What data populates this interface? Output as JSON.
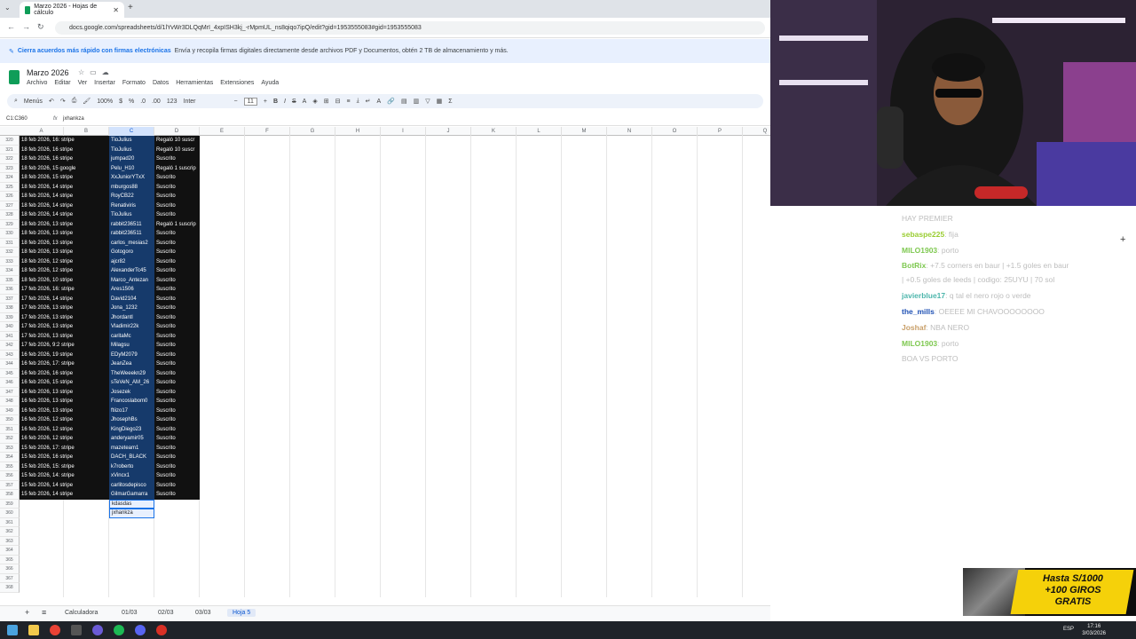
{
  "browser": {
    "tab_title": "Marzo 2026 - Hojas de cálculo",
    "url": "docs.google.com/spreadsheets/d/1lYvWr3DLQqMrI_4xpISH3kj_-rMpmUL_ns8qiqo7ipQ/edit?gid=1953555083#gid=1953555083"
  },
  "banner": {
    "bold": "Cierra acuerdos más rápido con firmas electrónicas",
    "text": "Envía y recopila firmas digitales directamente desde archivos PDF y Documentos, obtén 2 TB de almacenamiento y más."
  },
  "doc": {
    "title": "Marzo 2026",
    "menu": [
      "Archivo",
      "Editar",
      "Ver",
      "Insertar",
      "Formato",
      "Datos",
      "Herramientas",
      "Extensiones",
      "Ayuda"
    ]
  },
  "toolbar": {
    "menus": "Menús",
    "zoom": "100%",
    "currency": "$",
    "percent": "%",
    "num": "123",
    "font": "Inter",
    "size": "11"
  },
  "formula": {
    "ref": "C1:C360",
    "value": "jxhankza"
  },
  "columns": [
    "A",
    "B",
    "C",
    "D",
    "E",
    "F",
    "G",
    "H",
    "I",
    "J",
    "K",
    "L",
    "M",
    "N",
    "O",
    "P",
    "Q"
  ],
  "rows": [
    {
      "n": "320",
      "a": "18 feb 2026, 16: stripe",
      "c": "TioJulius",
      "d": "Regaló 10 suscr"
    },
    {
      "n": "321",
      "a": "18 feb 2026, 16 stripe",
      "c": "TioJulius",
      "d": "Regaló 10 suscr"
    },
    {
      "n": "322",
      "a": "18 feb 2026, 16 stripe",
      "c": "jumpad20",
      "d": "Suscrito"
    },
    {
      "n": "323",
      "a": "18 feb 2026, 15 google",
      "c": "Pelu_H10",
      "d": "Regaló 1 suscrip"
    },
    {
      "n": "324",
      "a": "18 feb 2026, 15 stripe",
      "c": "XxJuniorYTxX",
      "d": "Suscrito"
    },
    {
      "n": "325",
      "a": "18 feb 2026, 14 stripe",
      "c": "mburgos88",
      "d": "Suscrito"
    },
    {
      "n": "326",
      "a": "18 feb 2026, 14 stripe",
      "c": "RoyCB22",
      "d": "Suscrito"
    },
    {
      "n": "327",
      "a": "18 feb 2026, 14 stripe",
      "c": "Renativiris",
      "d": "Suscrito"
    },
    {
      "n": "328",
      "a": "18 feb 2026, 14 stripe",
      "c": "TioJulius",
      "d": "Suscrito"
    },
    {
      "n": "329",
      "a": "18 feb 2026, 13 stripe",
      "c": "rabbit236511",
      "d": "Regaló 1 suscrip"
    },
    {
      "n": "330",
      "a": "18 feb 2026, 13 stripe",
      "c": "rabbit236511",
      "d": "Suscrito"
    },
    {
      "n": "331",
      "a": "18 feb 2026, 13 stripe",
      "c": "carlos_mesias2",
      "d": "Suscrito"
    },
    {
      "n": "332",
      "a": "18 feb 2026, 13 stripe",
      "c": "Gotogoro",
      "d": "Suscrito"
    },
    {
      "n": "333",
      "a": "18 feb 2026, 12 stripe",
      "c": "ajcr82",
      "d": "Suscrito"
    },
    {
      "n": "334",
      "a": "18 feb 2026, 12 stripe",
      "c": "AlexanderTc45",
      "d": "Suscrito"
    },
    {
      "n": "335",
      "a": "18 feb 2026, 10 stripe",
      "c": "Marco_Antezan",
      "d": "Suscrito"
    },
    {
      "n": "336",
      "a": "17 feb 2026, 16: stripe",
      "c": "Ares1506",
      "d": "Suscrito"
    },
    {
      "n": "337",
      "a": "17 feb 2026, 14 stripe",
      "c": "David2104",
      "d": "Suscrito"
    },
    {
      "n": "338",
      "a": "17 feb 2026, 13 stripe",
      "c": "Jona_1232",
      "d": "Suscrito"
    },
    {
      "n": "339",
      "a": "17 feb 2026, 13 stripe",
      "c": "Jhordantl",
      "d": "Suscrito"
    },
    {
      "n": "340",
      "a": "17 feb 2026, 13 stripe",
      "c": "Vladimir22k",
      "d": "Suscrito"
    },
    {
      "n": "341",
      "a": "17 feb 2026, 13 stripe",
      "c": "caritaMc",
      "d": "Suscrito"
    },
    {
      "n": "342",
      "a": "17 feb 2026, 9:2 stripe",
      "c": "Milagsu",
      "d": "Suscrito"
    },
    {
      "n": "343",
      "a": "16 feb 2026, 19 stripe",
      "c": "EDyM2079",
      "d": "Suscrito"
    },
    {
      "n": "344",
      "a": "16 feb 2026, 17: stripe",
      "c": "JeanZea",
      "d": "Suscrito"
    },
    {
      "n": "345",
      "a": "16 feb 2026, 16 stripe",
      "c": "TheWeeekn29",
      "d": "Suscrito"
    },
    {
      "n": "346",
      "a": "16 feb 2026, 15 stripe",
      "c": "sTeVeN_AM_26",
      "d": "Suscrito"
    },
    {
      "n": "347",
      "a": "16 feb 2026, 13 stripe",
      "c": "Josezek",
      "d": "Suscrito"
    },
    {
      "n": "348",
      "a": "16 feb 2026, 13 stripe",
      "c": "Francoslabom0",
      "d": "Suscrito"
    },
    {
      "n": "349",
      "a": "16 feb 2026, 13 stripe",
      "c": "ftiizo17",
      "d": "Suscrito"
    },
    {
      "n": "350",
      "a": "16 feb 2026, 12 stripe",
      "c": "JhosephBs",
      "d": "Suscrito"
    },
    {
      "n": "351",
      "a": "16 feb 2026, 12 stripe",
      "c": "KingDiego23",
      "d": "Suscrito"
    },
    {
      "n": "352",
      "a": "16 feb 2026, 12 stripe",
      "c": "anderyamir05",
      "d": "Suscrito"
    },
    {
      "n": "353",
      "a": "15 feb 2026, 17: stripe",
      "c": "mazeteam1",
      "d": "Suscrito"
    },
    {
      "n": "354",
      "a": "15 feb 2026, 16 stripe",
      "c": "DACH_BLACK",
      "d": "Suscrito"
    },
    {
      "n": "355",
      "a": "15 feb 2026, 15: stripe",
      "c": "k7roberto",
      "d": "Suscrito"
    },
    {
      "n": "356",
      "a": "15 feb 2026, 14: stripe",
      "c": "xVincx1",
      "d": "Suscrito"
    },
    {
      "n": "357",
      "a": "15 feb 2026, 14 stripe",
      "c": "carlitosdepisco",
      "d": "Suscrito"
    },
    {
      "n": "358",
      "a": "15 feb 2026, 14 stripe",
      "c": "GilmarGamarra",
      "d": "Suscrito"
    }
  ],
  "extra_rows": [
    {
      "n": "359",
      "c": "kdasdas"
    },
    {
      "n": "360",
      "c": "jxhankza"
    }
  ],
  "empty_rows": [
    "361",
    "362",
    "363",
    "364",
    "365",
    "366",
    "367",
    "368"
  ],
  "sheets": [
    "Calculadora",
    "01/03",
    "02/03",
    "03/03",
    "Hoja 5"
  ],
  "chat": [
    {
      "u": "",
      "m": "HAY PREMIER"
    },
    {
      "u": "sebaspe225",
      "m": ": fija",
      "c": "#9acd32"
    },
    {
      "u": "MILO1903",
      "m": ": porto",
      "c": "#7ec850"
    },
    {
      "u": "BotRix",
      "m": ": +7.5 corners en baur | +1.5 goles en baur",
      "c": "#7ec850"
    },
    {
      "u": "",
      "m": "| +0.5 goles de leeds | codigo: 25UYU | 70 sol"
    },
    {
      "u": "javierblue17",
      "m": ": q tal el nero rojo o verde",
      "c": "#4db6ac"
    },
    {
      "u": "the_mills",
      "m": ": OEEEE MI CHAVOOOOOOOO",
      "c": "#1e50b4"
    },
    {
      "u": "Joshaf",
      "m": ": NBA NERO",
      "c": "#c9a06a"
    },
    {
      "u": "MILO1903",
      "m": ": porto",
      "c": "#7ec850"
    },
    {
      "u": "",
      "m": "BOA VS PORTO"
    }
  ],
  "promo": {
    "line1": "Hasta S/1000",
    "line2": "+100 GIROS",
    "line3": "GRATIS"
  },
  "taskbar": {
    "lang": "ESP",
    "time": "17:16",
    "date": "3/03/2026"
  }
}
